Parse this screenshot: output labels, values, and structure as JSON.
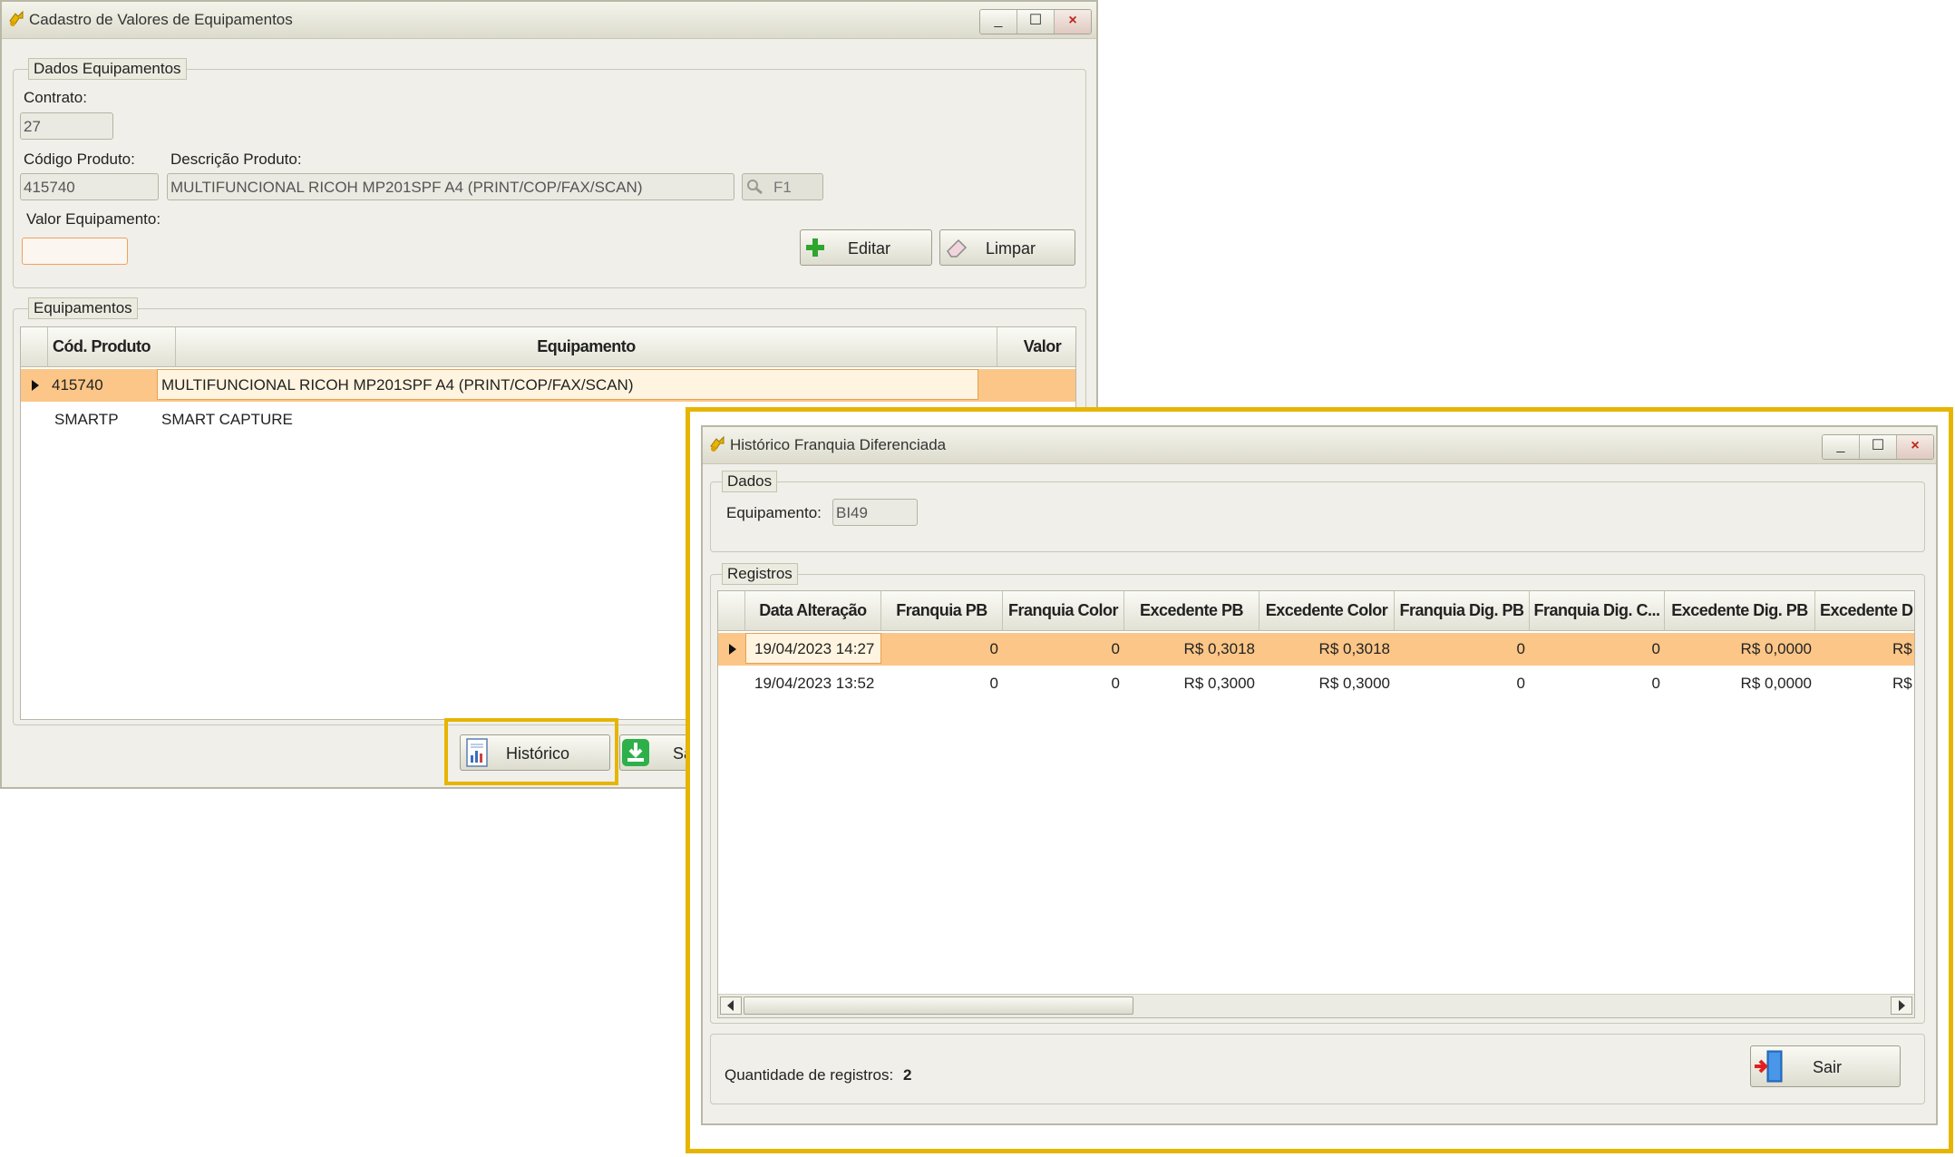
{
  "cad": {
    "title": "Cadastro de Valores de Equipamentos",
    "win_buttons": [
      "_",
      "☐",
      "×"
    ],
    "dados_legend": "Dados Equipamentos",
    "contrato_label": "Contrato:",
    "contrato_value": "27",
    "codigo_label": "Código Produto:",
    "codigo_value": "415740",
    "descricao_label": "Descrição Produto:",
    "descricao_value": "MULTIFUNCIONAL RICOH MP201SPF A4 (PRINT/COP/FAX/SCAN)",
    "search_key": "F1",
    "valor_label": "Valor Equipamento:",
    "valor_value": "",
    "editar": "Editar",
    "limpar": "Limpar",
    "equip_legend": "Equipamentos",
    "columns": [
      "Cód. Produto",
      "Equipamento",
      "Valor"
    ],
    "rows": [
      {
        "codigo": "415740",
        "equipamento": "MULTIFUNCIONAL RICOH MP201SPF A4 (PRINT/COP/FAX/SCAN)",
        "valor": ""
      },
      {
        "codigo": "SMARTP",
        "equipamento": "SMART CAPTURE",
        "valor": ""
      }
    ],
    "historico": "Histórico",
    "salvar_partial": "Sa"
  },
  "hist": {
    "title": "Histórico Franquia Diferenciada",
    "win_buttons": [
      "_",
      "☐",
      "×"
    ],
    "dados_legend": "Dados",
    "equip_label": "Equipamento:",
    "equip_value": "BI49",
    "reg_legend": "Registros",
    "columns": [
      "Data Alteração",
      "Franquia PB",
      "Franquia Color",
      "Excedente PB",
      "Excedente Color",
      "Franquia Dig. PB",
      "Franquia Dig. C...",
      "Excedente Dig. PB",
      "Excedente D"
    ],
    "rows": [
      [
        "19/04/2023 14:27",
        "0",
        "0",
        "R$ 0,3018",
        "R$ 0,3018",
        "0",
        "0",
        "R$ 0,0000",
        "R$"
      ],
      [
        "19/04/2023 13:52",
        "0",
        "0",
        "R$ 0,3000",
        "R$ 0,3000",
        "0",
        "0",
        "R$ 0,0000",
        "R$"
      ]
    ],
    "qtd_label": "Quantidade de registros:",
    "qtd_value": "2",
    "sair": "Sair"
  },
  "colors": {
    "highlight": "#e6b500",
    "selected_row": "#fbc687",
    "accent_orange": "#f0a060"
  }
}
